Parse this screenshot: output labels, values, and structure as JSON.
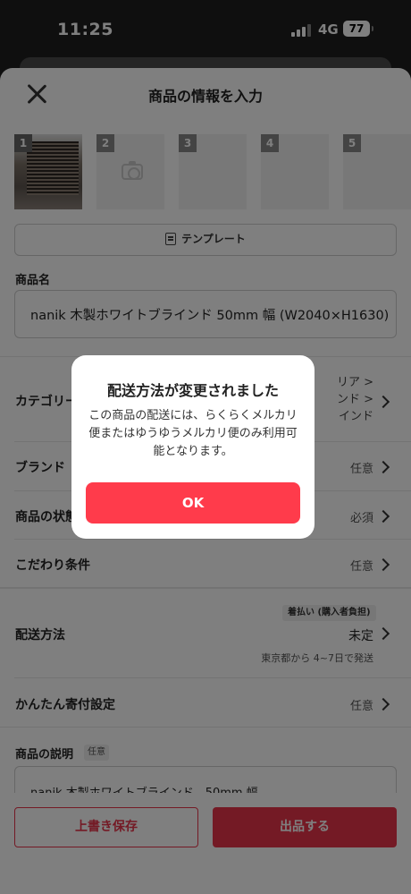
{
  "status_bar": {
    "time": "11:25",
    "network": "4G",
    "battery": "77"
  },
  "header": {
    "title": "商品の情報を入力"
  },
  "photos": [
    "1",
    "2",
    "3",
    "4",
    "5"
  ],
  "template_button": "テンプレート",
  "product_name": {
    "label": "商品名",
    "value": "nanik 木製ホワイトブラインド 50mm 幅 (W2040×H1630)"
  },
  "rows": {
    "category": {
      "label": "カテゴリー",
      "value_lines": [
        "リア >",
        "ンド >",
        "インド"
      ]
    },
    "brand": {
      "label": "ブランド",
      "value": "任意"
    },
    "condition": {
      "label": "商品の状態",
      "value": "必須"
    },
    "preferences": {
      "label": "こだわり条件",
      "value": "任意"
    },
    "shipping": {
      "label": "配送方法",
      "tag": "着払い (購入者負担)",
      "value": "未定",
      "sub": "東京都から 4~7日で発送"
    },
    "donation": {
      "label": "かんたん寄付設定",
      "value": "任意"
    }
  },
  "description": {
    "label": "商品の説明",
    "badge": "任意",
    "value": "nanik 木製ホワイトブラインド　50mm 幅"
  },
  "bottom": {
    "save": "上書き保存",
    "list": "出品する"
  },
  "dialog": {
    "title": "配送方法が変更されました",
    "body": "この商品の配送には、らくらくメルカリ便またはゆうゆうメルカリ便のみ利用可能となります。",
    "ok": "OK"
  },
  "colors": {
    "accent": "#ff3b4b"
  }
}
